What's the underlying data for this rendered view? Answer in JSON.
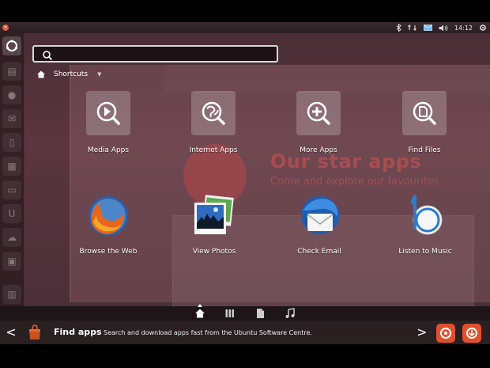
{
  "top_panel": {
    "time": "14:12",
    "indicators": [
      "bluetooth-icon",
      "network-icon",
      "mail-icon",
      "volume-icon",
      "gear-icon"
    ]
  },
  "search": {
    "placeholder": "",
    "value": ""
  },
  "filter": {
    "label": "Shortcuts"
  },
  "shortcuts": [
    {
      "label": "Media Apps",
      "icon": "media-apps-icon"
    },
    {
      "label": "Internet Apps",
      "icon": "internet-apps-icon"
    },
    {
      "label": "More Apps",
      "icon": "more-apps-icon"
    },
    {
      "label": "Find Files",
      "icon": "find-files-icon"
    }
  ],
  "apps": [
    {
      "label": "Browse the Web",
      "icon": "firefox-icon"
    },
    {
      "label": "View Photos",
      "icon": "photos-icon"
    },
    {
      "label": "Check Email",
      "icon": "thunderbird-icon"
    },
    {
      "label": "Listen to Music",
      "icon": "banshee-icon"
    }
  ],
  "background": {
    "headline": "Our star apps",
    "subline": "Come and explore our favourites"
  },
  "lens_bar": {
    "lenses": [
      "home-icon",
      "applications-icon",
      "files-icon",
      "music-icon"
    ],
    "active": 0
  },
  "bottom_bar": {
    "title": "Find apps",
    "description": "Search and download apps fast from the Ubuntu Software Centre.",
    "prev": "<",
    "next": ">"
  },
  "colors": {
    "accent": "#e0502c",
    "dash_bg": "#4a2d36",
    "panel_bg": "#2a1e22"
  }
}
